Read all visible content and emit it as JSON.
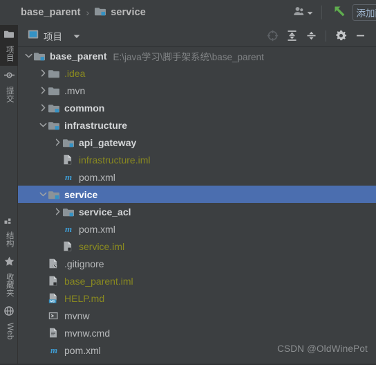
{
  "breadcrumb": {
    "root": "base_parent",
    "separator": "›",
    "current": "service"
  },
  "topbar": {
    "user_icon": "user-icon",
    "dropdown_icon": "chevron-down-icon",
    "run_icon": "green-arrow-icon",
    "add_config_label": "添加配"
  },
  "panel": {
    "title": "项目",
    "title_icon": "project-panel-icon",
    "dropdown_icon": "chevron-down-icon",
    "icons": [
      {
        "name": "locate-target-icon",
        "label": "定位"
      },
      {
        "name": "expand-all-icon",
        "label": "展开全部"
      },
      {
        "name": "collapse-all-icon",
        "label": "折叠全部"
      },
      {
        "name": "gear-icon",
        "label": "设置"
      },
      {
        "name": "minimize-icon",
        "label": "隐藏"
      }
    ]
  },
  "sidebar": {
    "items": [
      {
        "label": "项目",
        "icon": "folder-icon",
        "active": true,
        "latin": false
      },
      {
        "label": "提交",
        "icon": "commit-icon",
        "active": false,
        "latin": false
      },
      {
        "label": "结构",
        "icon": "structure-icon",
        "active": false,
        "latin": false
      },
      {
        "label": "收藏夹",
        "icon": "star-icon",
        "active": false,
        "latin": false
      },
      {
        "label": "Web",
        "icon": "web-icon",
        "active": false,
        "latin": true
      }
    ]
  },
  "tree": {
    "rows": [
      {
        "indent": 0,
        "arrow": "down",
        "icon": "module-folder-icon",
        "label": "base_parent",
        "style": "bold",
        "path": "E:\\java学习\\脚手架系统\\base_parent",
        "selected": false
      },
      {
        "indent": 1,
        "arrow": "right",
        "icon": "folder-icon",
        "label": ".idea",
        "style": "olive",
        "path": "",
        "selected": false
      },
      {
        "indent": 1,
        "arrow": "right",
        "icon": "folder-icon",
        "label": ".mvn",
        "style": "gray",
        "path": "",
        "selected": false
      },
      {
        "indent": 1,
        "arrow": "right",
        "icon": "module-folder-icon",
        "label": "common",
        "style": "bold",
        "path": "",
        "selected": false
      },
      {
        "indent": 1,
        "arrow": "down",
        "icon": "module-folder-icon",
        "label": "infrastructure",
        "style": "bold",
        "path": "",
        "selected": false
      },
      {
        "indent": 2,
        "arrow": "right",
        "icon": "module-folder-icon",
        "label": "api_gateway",
        "style": "bold",
        "path": "",
        "selected": false
      },
      {
        "indent": 2,
        "arrow": "none",
        "icon": "iml-file-icon",
        "label": "infrastructure.iml",
        "style": "olive",
        "path": "",
        "selected": false
      },
      {
        "indent": 2,
        "arrow": "none",
        "icon": "maven-pom-icon",
        "label": "pom.xml",
        "style": "gray",
        "path": "",
        "selected": false
      },
      {
        "indent": 1,
        "arrow": "down",
        "icon": "module-folder-icon",
        "label": "service",
        "style": "bold",
        "path": "",
        "selected": true
      },
      {
        "indent": 2,
        "arrow": "right",
        "icon": "module-folder-icon",
        "label": "service_acl",
        "style": "bold",
        "path": "",
        "selected": false
      },
      {
        "indent": 2,
        "arrow": "none",
        "icon": "maven-pom-icon",
        "label": "pom.xml",
        "style": "gray",
        "path": "",
        "selected": false
      },
      {
        "indent": 2,
        "arrow": "none",
        "icon": "iml-file-icon",
        "label": "service.iml",
        "style": "olive",
        "path": "",
        "selected": false
      },
      {
        "indent": 1,
        "arrow": "none",
        "icon": "gitignore-file-icon",
        "label": ".gitignore",
        "style": "gray",
        "path": "",
        "selected": false
      },
      {
        "indent": 1,
        "arrow": "none",
        "icon": "iml-file-icon",
        "label": "base_parent.iml",
        "style": "olive",
        "path": "",
        "selected": false
      },
      {
        "indent": 1,
        "arrow": "none",
        "icon": "markdown-file-icon",
        "label": "HELP.md",
        "style": "olive",
        "path": "",
        "selected": false
      },
      {
        "indent": 1,
        "arrow": "none",
        "icon": "shell-script-icon",
        "label": "mvnw",
        "style": "gray",
        "path": "",
        "selected": false
      },
      {
        "indent": 1,
        "arrow": "none",
        "icon": "text-file-icon",
        "label": "mvnw.cmd",
        "style": "gray",
        "path": "",
        "selected": false
      },
      {
        "indent": 1,
        "arrow": "none",
        "icon": "maven-pom-icon",
        "label": "pom.xml",
        "style": "gray",
        "path": "",
        "selected": false
      }
    ]
  },
  "watermark": "CSDN @OldWinePot",
  "colors": {
    "background": "#3c3f41",
    "selection": "#4b6eaf",
    "text": "#b9bbbd",
    "bold_text": "#d4d6d8",
    "olive": "#8a8a20",
    "path": "#808385",
    "maven_blue": "#3f9dd4",
    "folder": "#8b9398",
    "accent_cyan": "#3592c4",
    "green": "#5fad4e"
  }
}
